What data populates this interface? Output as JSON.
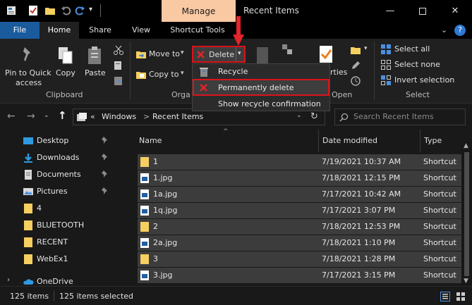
{
  "titlebar": {
    "manage_label": "Manage",
    "window_title": "Recent Items"
  },
  "ribbon_tabs": {
    "file": "File",
    "home": "Home",
    "share": "Share",
    "view": "View",
    "shortcut_tools": "Shortcut Tools"
  },
  "ribbon": {
    "pin_to_quick_access_line1": "Pin to Quick",
    "pin_to_quick_access_line2": "access",
    "copy": "Copy",
    "paste": "Paste",
    "move_to": "Move to",
    "copy_to": "Copy to",
    "delete": "Delete",
    "properties_partial": "rties",
    "select_all": "Select all",
    "select_none": "Select none",
    "invert_selection": "Invert selection",
    "group_clipboard": "Clipboard",
    "group_organize_partial": "Orga",
    "group_open_partial": "Open",
    "group_select": "Select"
  },
  "delete_menu": {
    "recycle": "Recycle",
    "permanently_delete": "Permanently delete",
    "show_recycle_confirmation": "Show recycle confirmation"
  },
  "address": {
    "prefix": "«",
    "crumb1": "Windows",
    "sep": ">",
    "crumb2": "Recent Items",
    "search_placeholder": "Search Recent Items"
  },
  "nav": {
    "items": [
      {
        "label": "Desktop",
        "pinned": true
      },
      {
        "label": "Downloads",
        "pinned": true
      },
      {
        "label": "Documents",
        "pinned": true
      },
      {
        "label": "Pictures",
        "pinned": true
      },
      {
        "label": "4",
        "pinned": false
      },
      {
        "label": "BLUETOOTH",
        "pinned": false
      },
      {
        "label": "RECENT",
        "pinned": false
      },
      {
        "label": "WebEx1",
        "pinned": false
      },
      {
        "label": "OneDrive",
        "pinned": false
      }
    ]
  },
  "columns": {
    "name": "Name",
    "date_modified": "Date modified",
    "type": "Type"
  },
  "files": [
    {
      "name": "1",
      "date": "7/19/2021 10:37 AM",
      "type": "Shortcut",
      "icon": "folder-icon"
    },
    {
      "name": "1.jpg",
      "date": "7/18/2021 12:15 PM",
      "type": "Shortcut",
      "icon": "image-file-icon"
    },
    {
      "name": "1a.jpg",
      "date": "7/17/2021 10:42 AM",
      "type": "Shortcut",
      "icon": "image-file-icon"
    },
    {
      "name": "1q.jpg",
      "date": "7/17/2021 3:07 PM",
      "type": "Shortcut",
      "icon": "image-file-icon"
    },
    {
      "name": "2",
      "date": "7/18/2021 12:53 PM",
      "type": "Shortcut",
      "icon": "folder-icon"
    },
    {
      "name": "2a.jpg",
      "date": "7/18/2021 1:10 PM",
      "type": "Shortcut",
      "icon": "image-file-icon"
    },
    {
      "name": "3",
      "date": "7/18/2021 1:28 PM",
      "type": "Shortcut",
      "icon": "folder-icon"
    },
    {
      "name": "3.jpg",
      "date": "7/17/2021 3:15 PM",
      "type": "Shortcut",
      "icon": "image-file-icon"
    }
  ],
  "status": {
    "item_count": "125 items",
    "selected_count": "125 items selected"
  },
  "colors": {
    "accent_file_tab": "#1a5b9e",
    "manage_tab": "#f9c9a3",
    "highlight_red": "#d9141b",
    "folder_yellow": "#f5cf5f"
  }
}
